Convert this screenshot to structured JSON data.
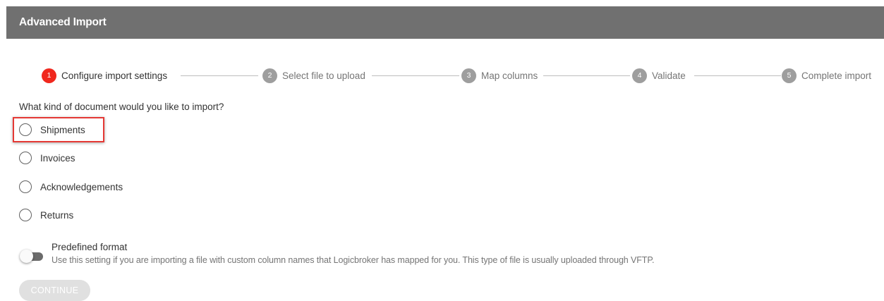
{
  "header": {
    "title": "Advanced Import"
  },
  "stepper": {
    "steps": [
      {
        "number": "1",
        "label": "Configure import settings",
        "active": true
      },
      {
        "number": "2",
        "label": "Select file to upload",
        "active": false
      },
      {
        "number": "3",
        "label": "Map columns",
        "active": false
      },
      {
        "number": "4",
        "label": "Validate",
        "active": false
      },
      {
        "number": "5",
        "label": "Complete import",
        "active": false
      }
    ]
  },
  "form": {
    "question": "What kind of document would you like to import?",
    "options": [
      {
        "label": "Shipments",
        "selected": false,
        "highlighted": true
      },
      {
        "label": "Invoices",
        "selected": false
      },
      {
        "label": "Acknowledgements",
        "selected": false
      },
      {
        "label": "Returns",
        "selected": false
      }
    ],
    "predefined": {
      "title": "Predefined format",
      "description": "Use this setting if you are importing a file with custom column names that Logicbroker has mapped for you. This type of file is usually uploaded through VFTP.",
      "enabled": false
    },
    "continue_label": "CONTINUE",
    "continue_disabled": true
  },
  "colors": {
    "header_bg": "#707070",
    "active_step": "#f0281e",
    "inactive_step": "#9e9e9e",
    "highlight_border": "#e53935",
    "disabled_button": "#e0e0e0"
  }
}
